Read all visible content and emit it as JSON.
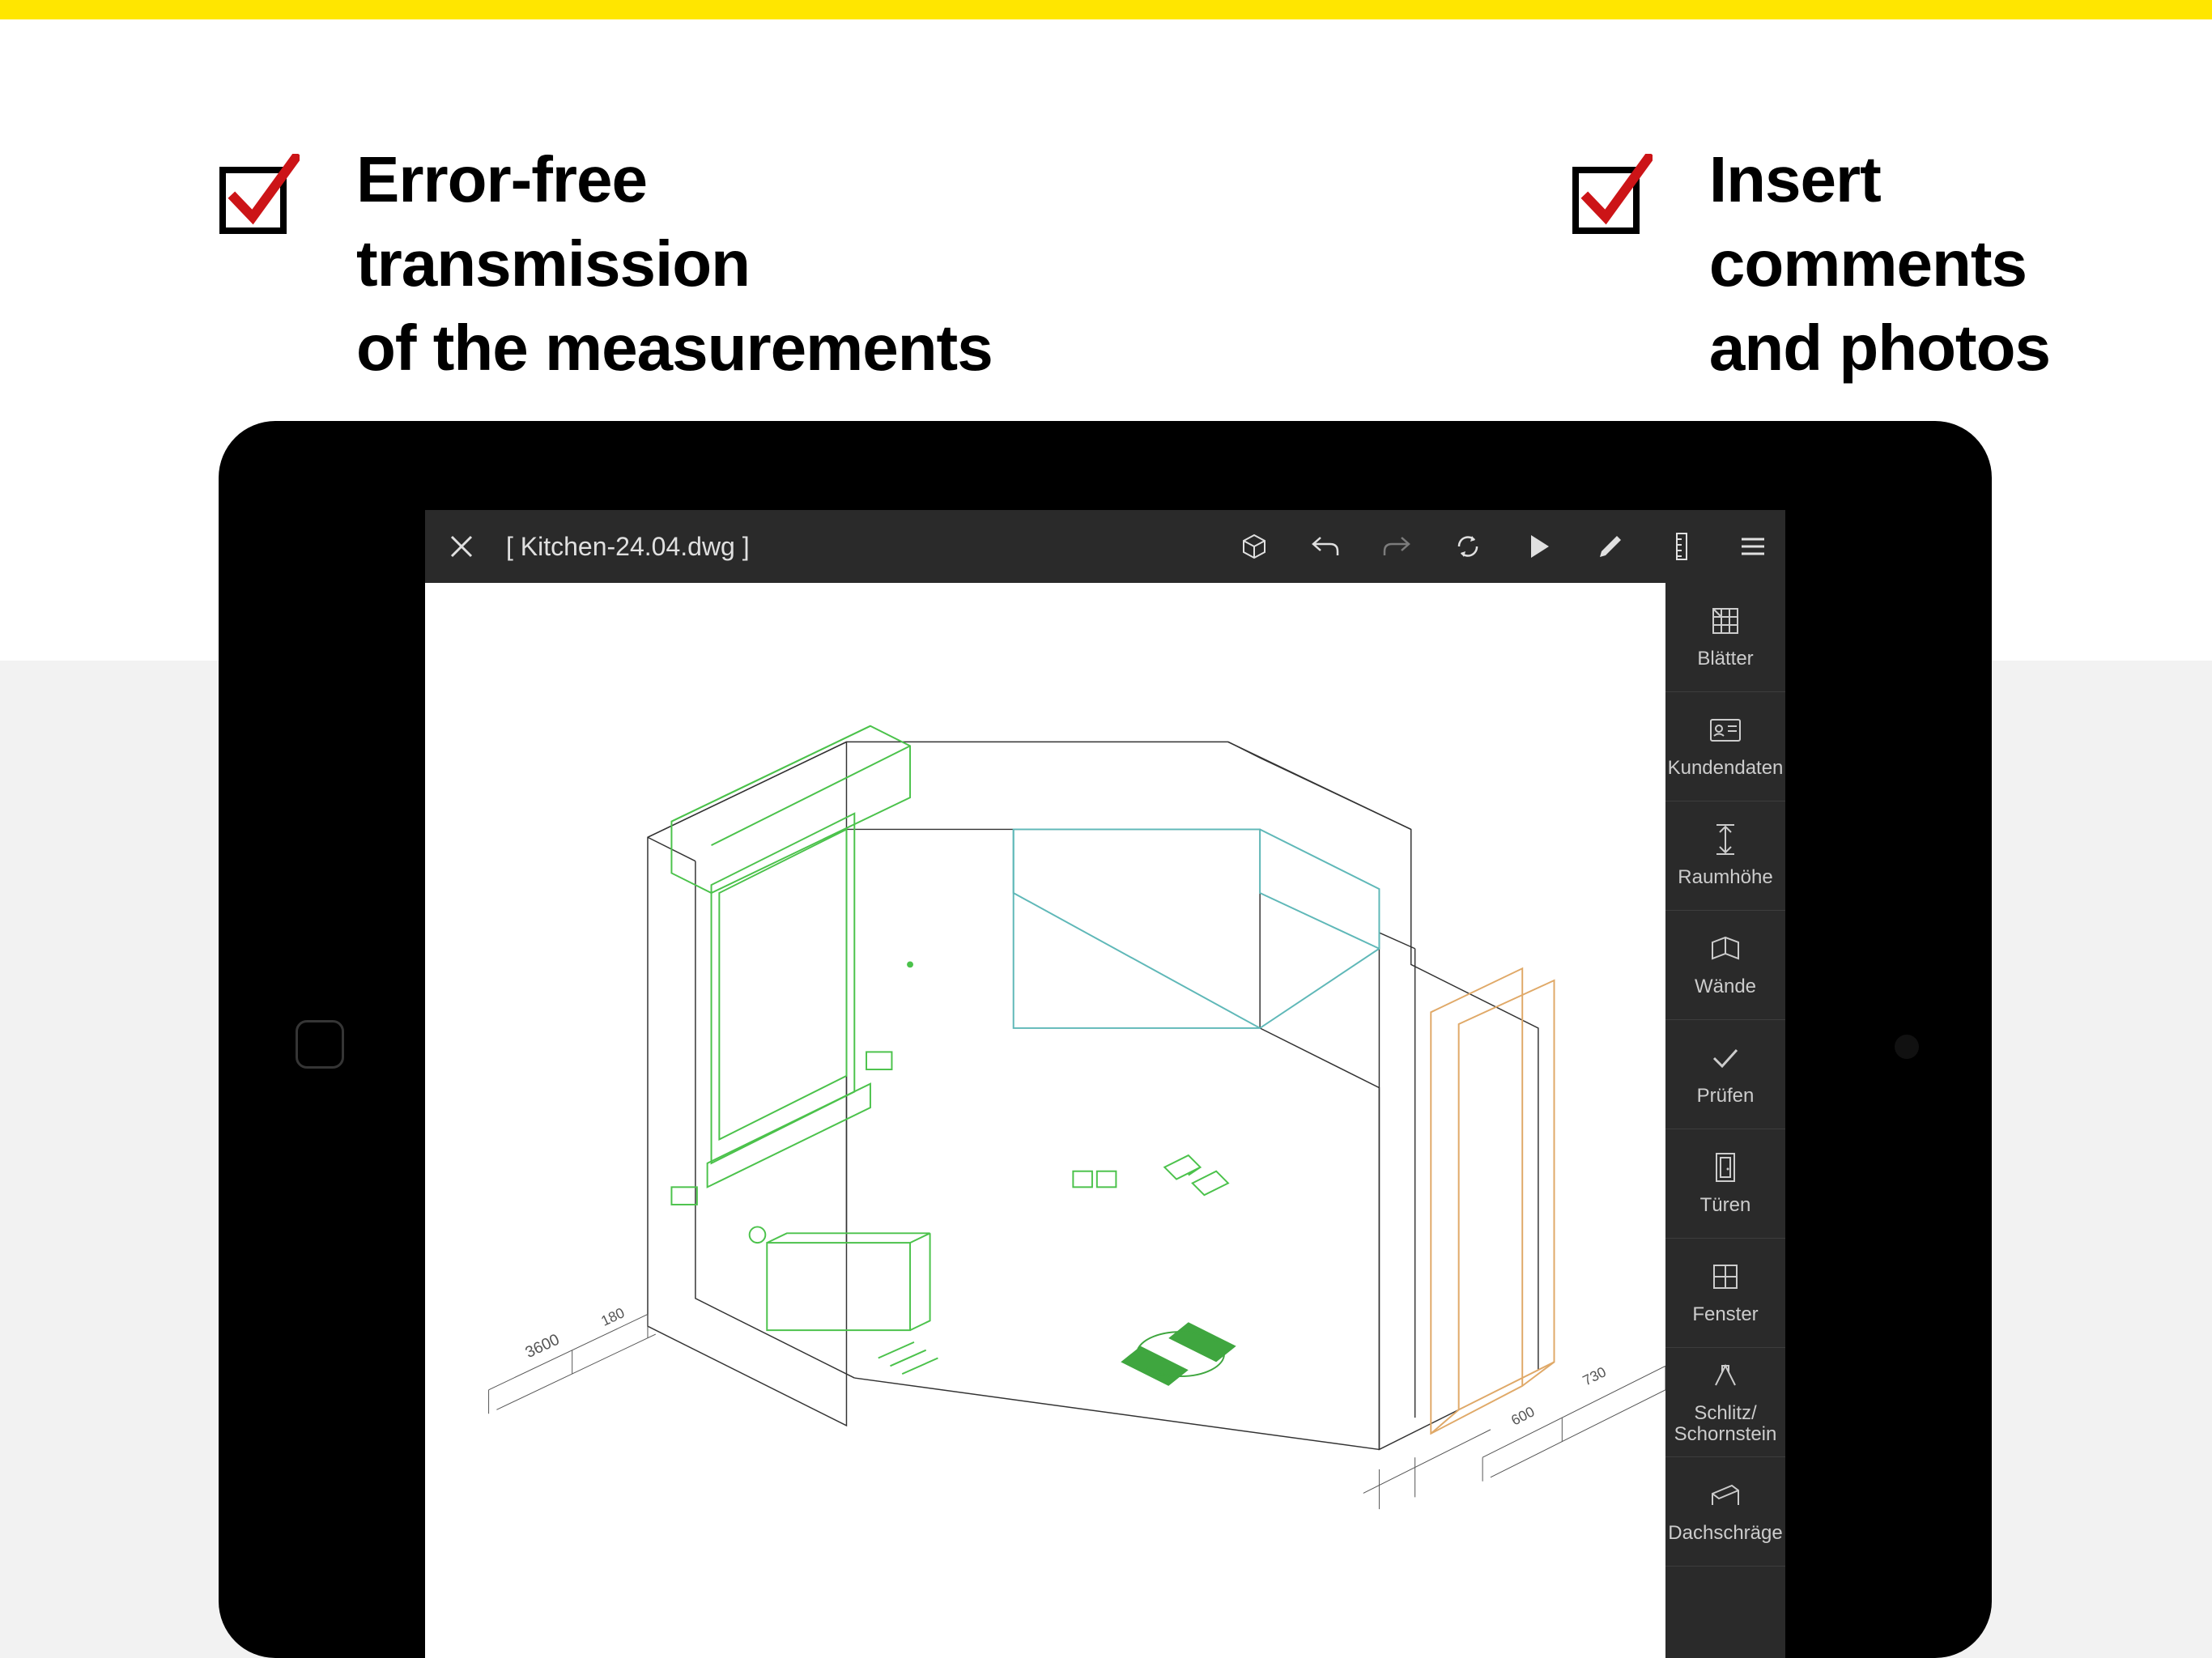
{
  "banner": {
    "color": "#ffe600"
  },
  "features": [
    {
      "text_line1": "Error-free transmission",
      "text_line2": "of the measurements"
    },
    {
      "text_line1": "Insert comments",
      "text_line2": "and photos"
    }
  ],
  "app": {
    "filename": "[ Kitchen-24.04.dwg ]",
    "toolbar": [
      {
        "name": "cube-3d-icon",
        "dimmed": false
      },
      {
        "name": "undo-icon",
        "dimmed": false
      },
      {
        "name": "redo-icon",
        "dimmed": true
      },
      {
        "name": "sync-icon",
        "dimmed": false
      },
      {
        "name": "play-icon",
        "dimmed": false
      },
      {
        "name": "edit-icon",
        "dimmed": false
      },
      {
        "name": "ruler-icon",
        "dimmed": false
      },
      {
        "name": "menu-icon",
        "dimmed": false
      }
    ],
    "side_panel": [
      {
        "icon": "grid-icon",
        "label": "Blätter"
      },
      {
        "icon": "card-icon",
        "label": "Kundendaten"
      },
      {
        "icon": "height-icon",
        "label": "Raumhöhe"
      },
      {
        "icon": "wall-icon",
        "label": "Wände"
      },
      {
        "icon": "check-icon",
        "label": "Prüfen"
      },
      {
        "icon": "door-icon",
        "label": "Türen"
      },
      {
        "icon": "window-icon",
        "label": "Fenster"
      },
      {
        "icon": "chimney-icon",
        "label": "Schlitz/\nSchornstein"
      },
      {
        "icon": "roof-icon",
        "label": "Dachschräge"
      }
    ]
  },
  "colors": {
    "accent_yellow": "#ffe600",
    "check_red": "#cc1417",
    "drawing_green": "#5dd35d",
    "drawing_teal": "#6cc5c5",
    "drawing_orange": "#e8b882",
    "drawing_line": "#333333"
  }
}
